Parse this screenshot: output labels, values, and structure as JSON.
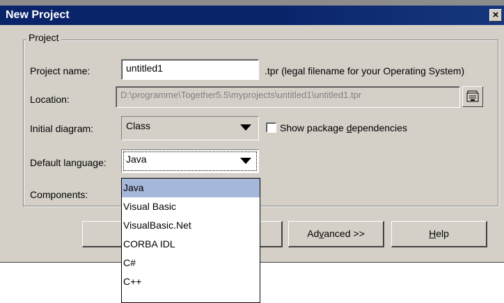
{
  "dialog": {
    "title": "New Project",
    "close_glyph": "×"
  },
  "group": {
    "legend": "Project"
  },
  "fields": {
    "project_name_label": "Project name:",
    "project_name_value": "untitled1",
    "project_name_hint": ".tpr (legal filename for your Operating System)",
    "location_label": "Location:",
    "location_value": "D:\\programme\\Together5.5\\myprojects\\untitled1\\untitled1.tpr",
    "initial_diagram_label": "Initial diagram:",
    "initial_diagram_value": "Class",
    "show_deps_pre": "Show package ",
    "show_deps_u": "d",
    "show_deps_post": "ependencies",
    "default_language_label": "Default language:",
    "default_language_value": "Java",
    "components_label": "Components:"
  },
  "language_options": [
    "Java",
    "Visual Basic",
    "VisualBasic.Net",
    "CORBA IDL",
    "C#",
    "C++"
  ],
  "buttons": {
    "advanced_pre": "Ad",
    "advanced_u": "v",
    "advanced_post": "anced >>",
    "help_u": "H",
    "help_post": "elp"
  },
  "icons": {
    "browse": "folder-browse-icon",
    "dropdown": "chevron-down-icon",
    "close": "close-icon"
  }
}
